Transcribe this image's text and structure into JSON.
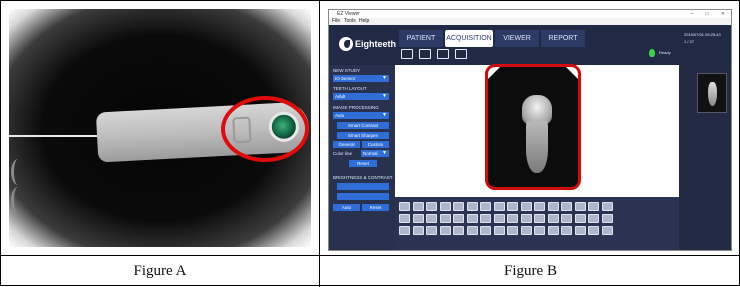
{
  "captions": {
    "figure_a": "Figure A",
    "figure_b": "Figure B"
  },
  "app": {
    "title": "EZ Viewer",
    "menu": [
      "File",
      "Tools",
      "Help"
    ],
    "window_controls": "– ▭ ✕",
    "logo_text": "Eighteeth",
    "tabs": [
      "PATIENT",
      "ACQUISITION",
      "VIEWER",
      "REPORT"
    ],
    "active_tab": "ACQUISITION",
    "status": "Ready",
    "info_line1": "2019/07/01 09:25:43",
    "info_line2": "1 / 27",
    "left_panel": {
      "new_study_label": "NEW STUDY",
      "new_study_value": "IO Sensor",
      "teeth_layout_label": "TEETH LAYOUT",
      "teeth_layout_value": "Adult",
      "image_processing_label": "IMAGE PROCESSING",
      "image_processing_value": "Auto",
      "smart_contrast": "Smart Contrast",
      "smart_sharpen": "Smart Sharpen",
      "general": "General",
      "custom": "Custom",
      "color_line_label": "Color line",
      "color_line_value": "Normal",
      "reset": "Reset",
      "brightness_label": "BRIGHTNESS & CONTRAST",
      "auto": "Auto",
      "reset2": "Reset"
    }
  },
  "colors": {
    "red_highlight": "#e10b0b",
    "active_tab_bg": "#ffffff",
    "tab_bg": "#2c3a66",
    "panel_button": "#2f6ed6",
    "status_led": "#3ad14b"
  },
  "icons": [
    "cable",
    "sensor-button",
    "import-icon",
    "export-icon",
    "compare-icon",
    "print-icon"
  ]
}
